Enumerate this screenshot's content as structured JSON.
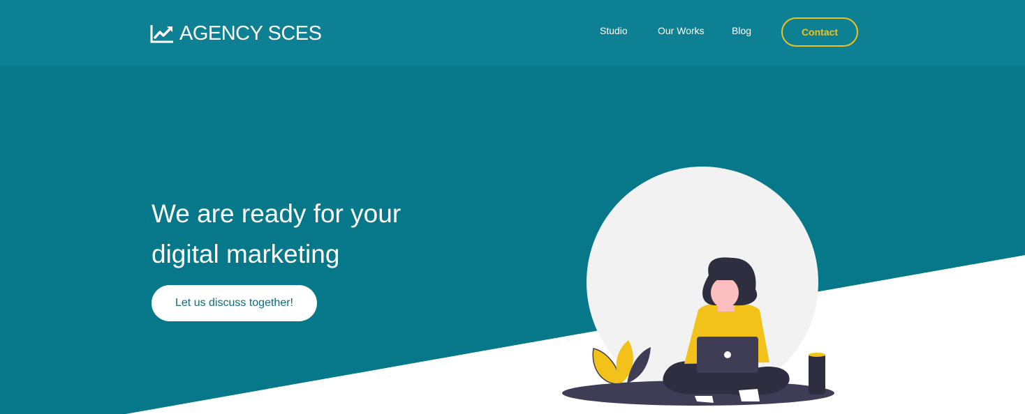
{
  "header": {
    "brand": "AGENCY SCES",
    "brand_icon": "trending-up-chart-icon",
    "nav": [
      {
        "label": "Studio"
      },
      {
        "label": "Our Works"
      },
      {
        "label": "Blog"
      }
    ],
    "contact_label": "Contact"
  },
  "hero": {
    "title_line1": "We are ready for your",
    "title_line2": "digital marketing",
    "cta_label": "Let us discuss together!"
  },
  "colors": {
    "background": "#067889",
    "header": "#0d8094",
    "accent": "#f2c21b",
    "white": "#ffffff"
  }
}
